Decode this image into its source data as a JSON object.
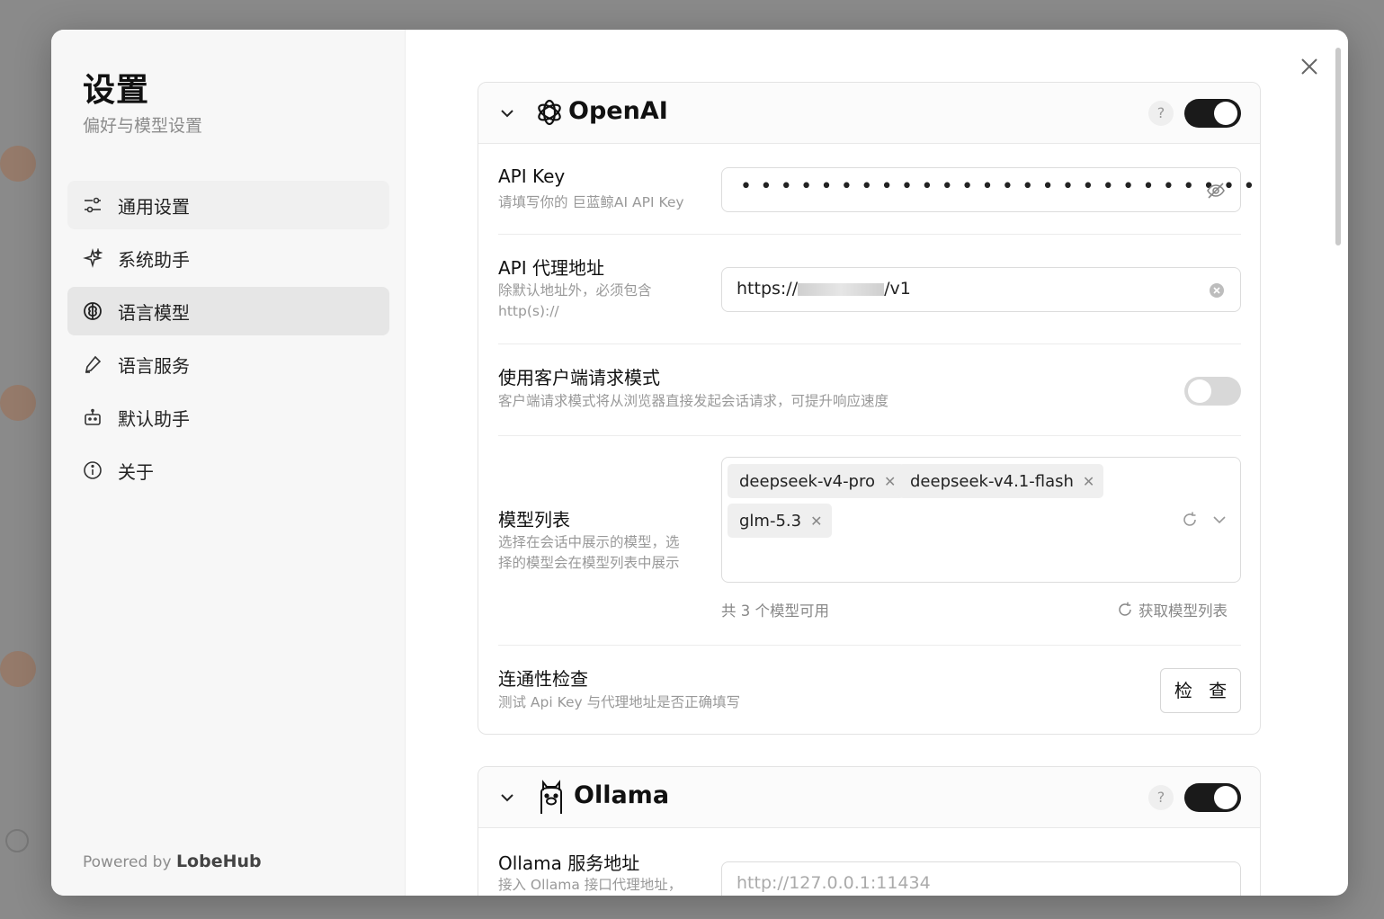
{
  "sidebar": {
    "title": "设置",
    "subtitle": "偏好与模型设置",
    "items": [
      {
        "label": "通用设置",
        "icon": "sliders-icon"
      },
      {
        "label": "系统助手",
        "icon": "sparkle-icon"
      },
      {
        "label": "语言模型",
        "icon": "brain-icon",
        "active": true
      },
      {
        "label": "语言服务",
        "icon": "pen-icon"
      },
      {
        "label": "默认助手",
        "icon": "robot-icon"
      },
      {
        "label": "关于",
        "icon": "info-icon"
      }
    ],
    "powered_prefix": "Powered by",
    "powered_brand": "LobeHub"
  },
  "openai": {
    "name": "OpenAI",
    "help": "?",
    "enabled": true,
    "api_key": {
      "label": "API Key",
      "desc": "请填写你的 巨蓝鲸AI API Key",
      "value_masked": "••••••••••••••••••••••••••"
    },
    "proxy": {
      "label": "API 代理地址",
      "desc_line1": "除默认地址外，必须包含",
      "desc_line2": "http(s)://",
      "value_prefix": "https://",
      "value_suffix": "/v1"
    },
    "client_mode": {
      "label": "使用客户端请求模式",
      "desc": "客户端请求模式将从浏览器直接发起会话请求，可提升响应速度",
      "enabled": false
    },
    "models": {
      "label": "模型列表",
      "desc_line1": "选择在会话中展示的模型，选",
      "desc_line2": "择的模型会在模型列表中展示",
      "tags": [
        "deepseek-v4-pro",
        "deepseek-v4.1-flash",
        "glm-5.3"
      ],
      "count_text": "共 3 个模型可用",
      "fetch_label": "获取模型列表"
    },
    "connectivity": {
      "label": "连通性检查",
      "desc": "测试 Api Key 与代理地址是否正确填写",
      "button": "检 查"
    }
  },
  "ollama": {
    "name": "Ollama",
    "help": "?",
    "enabled": true,
    "endpoint": {
      "label": "Ollama 服务地址",
      "desc": "接入 Ollama 接口代理地址，",
      "placeholder": "http://127.0.0.1:11434"
    }
  },
  "colors": {
    "accent": "#1a1a1a",
    "toggle_off": "#d8d8d8",
    "active_nav": "#e6e6e6"
  }
}
